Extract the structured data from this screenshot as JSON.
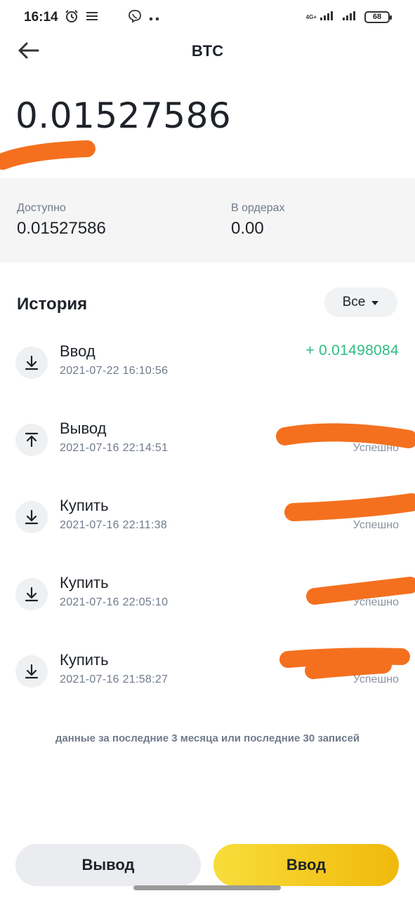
{
  "status_bar": {
    "time": "16:14",
    "network": "4G+",
    "battery": "68"
  },
  "header": {
    "title": "BTC"
  },
  "balance": {
    "total": "0.01527586"
  },
  "summary": {
    "available_label": "Доступно",
    "available_value": "0.01527586",
    "in_orders_label": "В ордерах",
    "in_orders_value": "0.00"
  },
  "history": {
    "title": "История",
    "filter_label": "Все",
    "items": [
      {
        "type": "Ввод",
        "date": "2021-07-22 16:10:56",
        "amount": "+ 0.01498084",
        "status": "",
        "direction": "in"
      },
      {
        "type": "Вывод",
        "date": "2021-07-16 22:14:51",
        "amount": "",
        "status": "Успешно",
        "direction": "out"
      },
      {
        "type": "Купить",
        "date": "2021-07-16 22:11:38",
        "amount": "",
        "status": "Успешно",
        "direction": "in"
      },
      {
        "type": "Купить",
        "date": "2021-07-16 22:05:10",
        "amount": "",
        "status": "Успешно",
        "direction": "in"
      },
      {
        "type": "Купить",
        "date": "2021-07-16 21:58:27",
        "amount": "",
        "status": "Успешно",
        "direction": "in"
      }
    ],
    "footer_note": "данные за последние 3 месяца или последние 30 записей"
  },
  "actions": {
    "withdraw_label": "Вывод",
    "deposit_label": "Ввод"
  },
  "colors": {
    "accent": "#f0b90b",
    "positive": "#2ebd85",
    "redaction": "#f4701f"
  },
  "icons": [
    "alarm-icon",
    "menu-lines-icon",
    "viber-icon",
    "more-dots-icon",
    "signal-icon",
    "battery-icon",
    "back-arrow-icon",
    "caret-down-icon",
    "arrow-down-tray-icon",
    "arrow-up-tray-icon"
  ]
}
